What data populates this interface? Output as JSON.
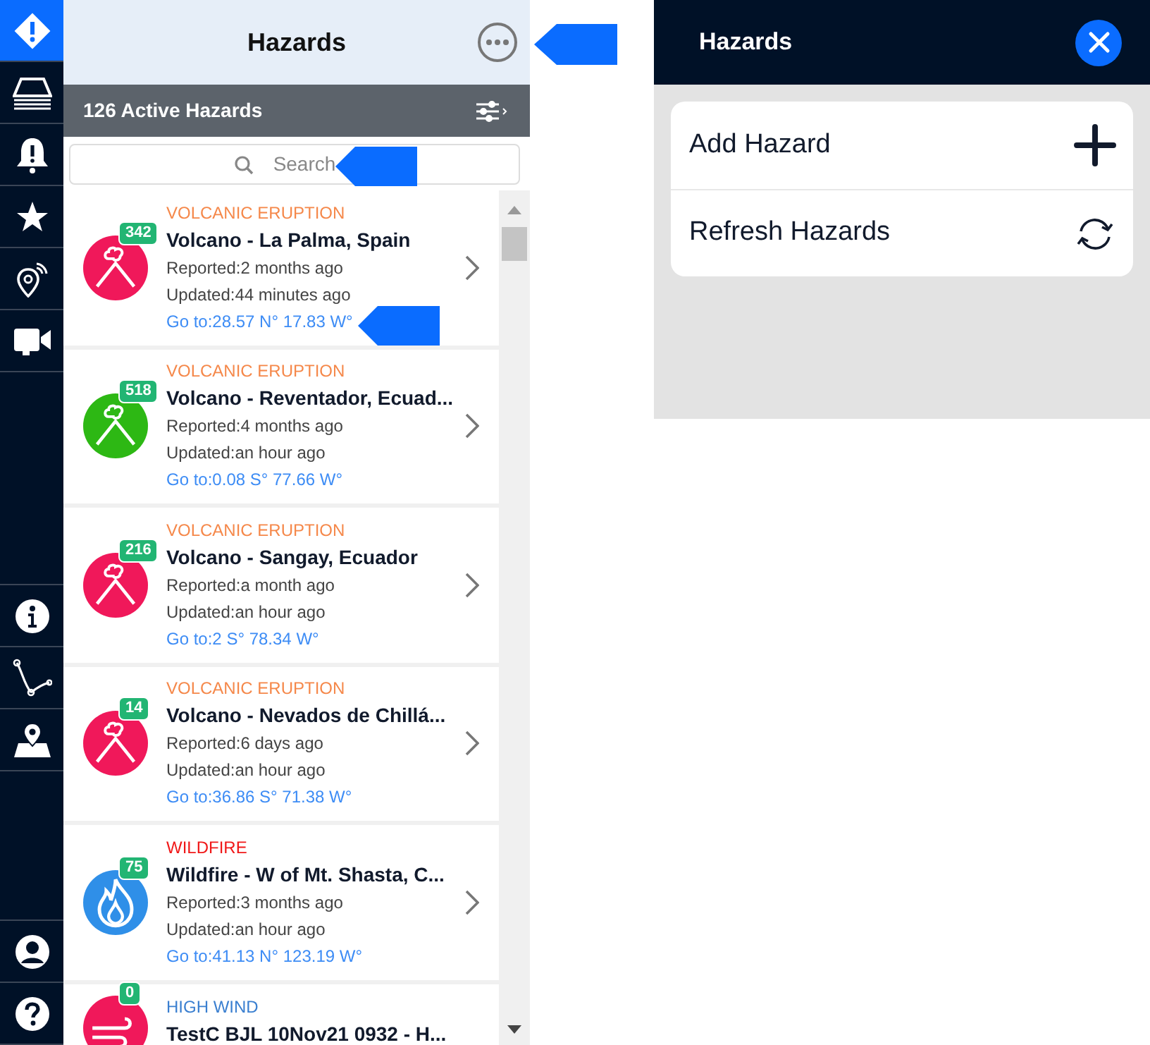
{
  "nav": {
    "top": [
      {
        "kind": "hazard",
        "selected": true
      },
      {
        "kind": "layers",
        "selected": false
      },
      {
        "kind": "alert",
        "selected": false
      },
      {
        "kind": "star",
        "selected": false
      },
      {
        "kind": "pin",
        "selected": false
      },
      {
        "kind": "video",
        "selected": false
      }
    ],
    "middle": [
      {
        "kind": "info",
        "selected": false
      },
      {
        "kind": "route",
        "selected": false
      },
      {
        "kind": "map",
        "selected": false
      }
    ],
    "bottom": [
      {
        "kind": "user",
        "selected": false
      },
      {
        "kind": "help",
        "selected": false
      }
    ]
  },
  "panel": {
    "title": "Hazards",
    "count_bar": "126 Active Hazards",
    "search": {
      "placeholder": "Search"
    },
    "hazards": [
      {
        "kind": "volcano",
        "color": "#f0185a",
        "badge": "342",
        "category": "VOLCANIC ERUPTION",
        "title": "Volcano - La Palma, Spain",
        "reported": "Reported:2 months ago",
        "updated": "Updated:44 minutes ago",
        "goto": "Go to:28.57 N° 17.83 W°"
      },
      {
        "kind": "volcano",
        "color": "#2db814",
        "badge": "518",
        "category": "VOLCANIC ERUPTION",
        "title": "Volcano - Reventador, Ecuad...",
        "reported": "Reported:4 months ago",
        "updated": "Updated:an hour ago",
        "goto": "Go to:0.08 S° 77.66 W°"
      },
      {
        "kind": "volcano",
        "color": "#f0185a",
        "badge": "216",
        "category": "VOLCANIC ERUPTION",
        "title": "Volcano - Sangay, Ecuador",
        "reported": "Reported:a month ago",
        "updated": "Updated:an hour ago",
        "goto": "Go to:2 S° 78.34 W°"
      },
      {
        "kind": "volcano",
        "color": "#f0185a",
        "badge": "14",
        "category": "VOLCANIC ERUPTION",
        "title": "Volcano - Nevados de Chillá...",
        "reported": "Reported:6 days ago",
        "updated": "Updated:an hour ago",
        "goto": "Go to:36.86 S° 71.38 W°"
      },
      {
        "kind": "wildfire",
        "color": "#2f8fe8",
        "badge": "75",
        "category": "WILDFIRE",
        "title": "Wildfire - W of Mt. Shasta, C...",
        "reported": "Reported:3 months ago",
        "updated": "Updated:an hour ago",
        "goto": "Go to:41.13 N° 123.19 W°"
      },
      {
        "kind": "wind",
        "color": "#f0185a",
        "badge": "0",
        "category": "HIGH WIND",
        "title": "TestC BJL 10Nov21 0932 - H..."
      }
    ]
  },
  "menu": {
    "title": "Hazards",
    "items": [
      {
        "kind": "add",
        "label": "Add Hazard"
      },
      {
        "kind": "refresh",
        "label": "Refresh Hazards"
      }
    ]
  }
}
